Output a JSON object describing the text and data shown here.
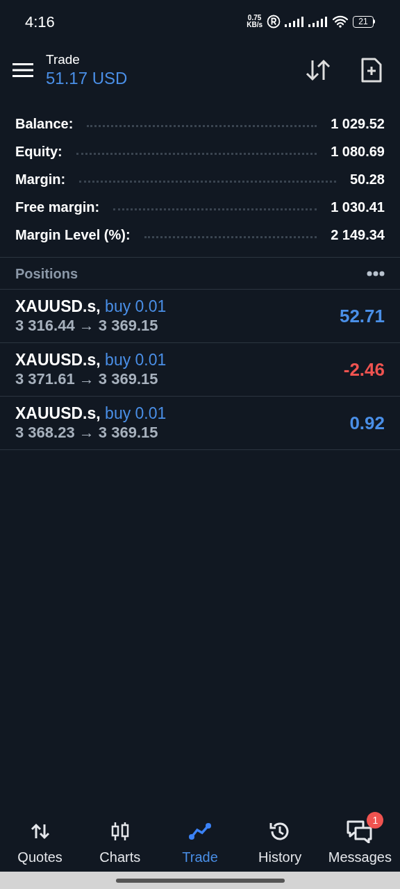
{
  "status_bar": {
    "time": "4:16",
    "speed_value": "0.75",
    "speed_unit": "KB/s",
    "battery": "21"
  },
  "header": {
    "title": "Trade",
    "profit": "51.17 USD"
  },
  "summary": [
    {
      "label": "Balance:",
      "value": "1 029.52"
    },
    {
      "label": "Equity:",
      "value": "1 080.69"
    },
    {
      "label": "Margin:",
      "value": "50.28"
    },
    {
      "label": "Free margin:",
      "value": "1 030.41"
    },
    {
      "label": "Margin Level (%):",
      "value": "2 149.34"
    }
  ],
  "positions": {
    "title": "Positions",
    "items": [
      {
        "symbol": "XAUUSD.s,",
        "order": "buy 0.01",
        "prices": "3 316.44 → 3 369.15",
        "profit": "52.71",
        "kind": "gain"
      },
      {
        "symbol": "XAUUSD.s,",
        "order": "buy 0.01",
        "prices": "3 371.61 → 3 369.15",
        "profit": "-2.46",
        "kind": "loss"
      },
      {
        "symbol": "XAUUSD.s,",
        "order": "buy 0.01",
        "prices": "3 368.23 → 3 369.15",
        "profit": "0.92",
        "kind": "gain"
      }
    ]
  },
  "bottom_nav": [
    {
      "label": "Quotes",
      "selected": false
    },
    {
      "label": "Charts",
      "selected": false
    },
    {
      "label": "Trade",
      "selected": true
    },
    {
      "label": "History",
      "selected": false
    },
    {
      "label": "Messages",
      "selected": false,
      "badge": "1"
    }
  ]
}
